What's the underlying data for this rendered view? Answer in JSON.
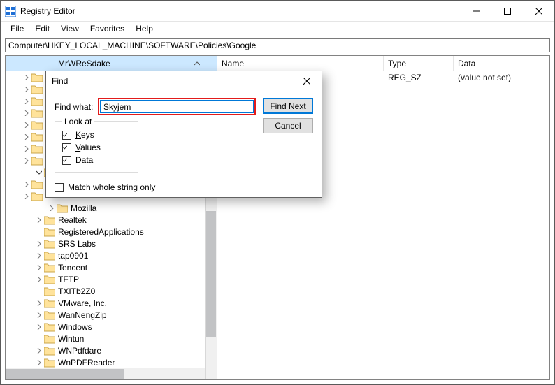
{
  "window": {
    "title": "Registry Editor"
  },
  "menu": {
    "file": "File",
    "edit": "Edit",
    "view": "View",
    "favorites": "Favorites",
    "help": "Help"
  },
  "address": "Computer\\HKEY_LOCAL_MACHINE\\SOFTWARE\\Policies\\Google",
  "tree": {
    "header": "MrWReSdake",
    "items": [
      {
        "indent": 60,
        "chev": ">",
        "label": "Mozilla"
      },
      {
        "indent": 42,
        "chev": ">",
        "label": "Realtek"
      },
      {
        "indent": 42,
        "chev": "",
        "label": "RegisteredApplications"
      },
      {
        "indent": 42,
        "chev": ">",
        "label": "SRS Labs"
      },
      {
        "indent": 42,
        "chev": ">",
        "label": "tap0901"
      },
      {
        "indent": 42,
        "chev": ">",
        "label": "Tencent"
      },
      {
        "indent": 42,
        "chev": ">",
        "label": "TFTP"
      },
      {
        "indent": 42,
        "chev": "",
        "label": "TXITb2Z0"
      },
      {
        "indent": 42,
        "chev": ">",
        "label": "VMware, Inc."
      },
      {
        "indent": 42,
        "chev": ">",
        "label": "WanNengZip"
      },
      {
        "indent": 42,
        "chev": ">",
        "label": "Windows"
      },
      {
        "indent": 42,
        "chev": "",
        "label": "Wintun"
      },
      {
        "indent": 42,
        "chev": ">",
        "label": "WNPdfdare"
      },
      {
        "indent": 42,
        "chev": ">",
        "label": "WnPDFReader"
      }
    ],
    "hidden_rows": 11
  },
  "list": {
    "columns": {
      "name": "Name",
      "type": "Type",
      "data": "Data"
    },
    "rows": [
      {
        "name": "",
        "type": "REG_SZ",
        "data": "(value not set)"
      }
    ]
  },
  "find": {
    "title": "Find",
    "find_what_label": "Find what:",
    "find_what_value": "Skyjem",
    "look_at": "Look at",
    "keys_u": "K",
    "keys_rest": "eys",
    "values_u": "V",
    "values_rest": "alues",
    "data_u": "D",
    "data_rest": "ata",
    "match_pre": "Match ",
    "match_u": "w",
    "match_post": "hole string only",
    "find_next_u": "F",
    "find_next_rest": "ind Next",
    "cancel": "Cancel",
    "keys_checked": true,
    "values_checked": true,
    "data_checked": true,
    "match_checked": false
  }
}
